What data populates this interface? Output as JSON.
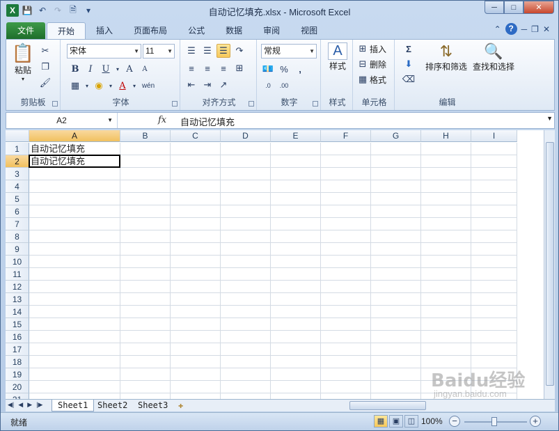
{
  "window": {
    "title": "自动记忆填充.xlsx - Microsoft Excel"
  },
  "quick_access": {
    "app_icon": "X"
  },
  "tabs": [
    {
      "label": "文件"
    },
    {
      "label": "开始"
    },
    {
      "label": "插入"
    },
    {
      "label": "页面布局"
    },
    {
      "label": "公式"
    },
    {
      "label": "数据"
    },
    {
      "label": "审阅"
    },
    {
      "label": "视图"
    }
  ],
  "ribbon": {
    "clipboard": {
      "label": "剪贴板",
      "paste": "粘贴"
    },
    "font": {
      "label": "字体",
      "name": "宋体",
      "size": "11",
      "bold": "B",
      "italic": "I",
      "underline": "U",
      "grow": "A",
      "shrink": "A",
      "color": "A",
      "phonetic": "wén"
    },
    "alignment": {
      "label": "对齐方式"
    },
    "number": {
      "label": "数字",
      "format": "常规",
      "percent": "%",
      "comma": ","
    },
    "styles": {
      "label": "样式",
      "button": "样式"
    },
    "cells": {
      "label": "单元格",
      "insert": "插入",
      "delete": "删除",
      "format": "格式"
    },
    "editing": {
      "label": "编辑",
      "sum": "Σ",
      "sort": "排序和筛选",
      "find": "查找和选择"
    }
  },
  "formula_bar": {
    "name_box": "A2",
    "fx": "fx",
    "content": "自动记忆填充"
  },
  "grid": {
    "columns": [
      "A",
      "B",
      "C",
      "D",
      "E",
      "F",
      "G",
      "H",
      "I"
    ],
    "rows": [
      "1",
      "2",
      "3",
      "4",
      "5",
      "6",
      "7",
      "8",
      "9",
      "10",
      "11",
      "12",
      "13",
      "14",
      "15",
      "16",
      "17",
      "18",
      "19",
      "20",
      "21"
    ],
    "cells": {
      "A1": "自动记忆填充",
      "A2": "自动记忆填充"
    }
  },
  "sheets": [
    {
      "label": "Sheet1"
    },
    {
      "label": "Sheet2"
    },
    {
      "label": "Sheet3"
    }
  ],
  "status": {
    "ready": "就绪",
    "zoom": "100%"
  },
  "watermark": {
    "text": "Baidu经验",
    "sub": "jingyan.baidu.com"
  }
}
